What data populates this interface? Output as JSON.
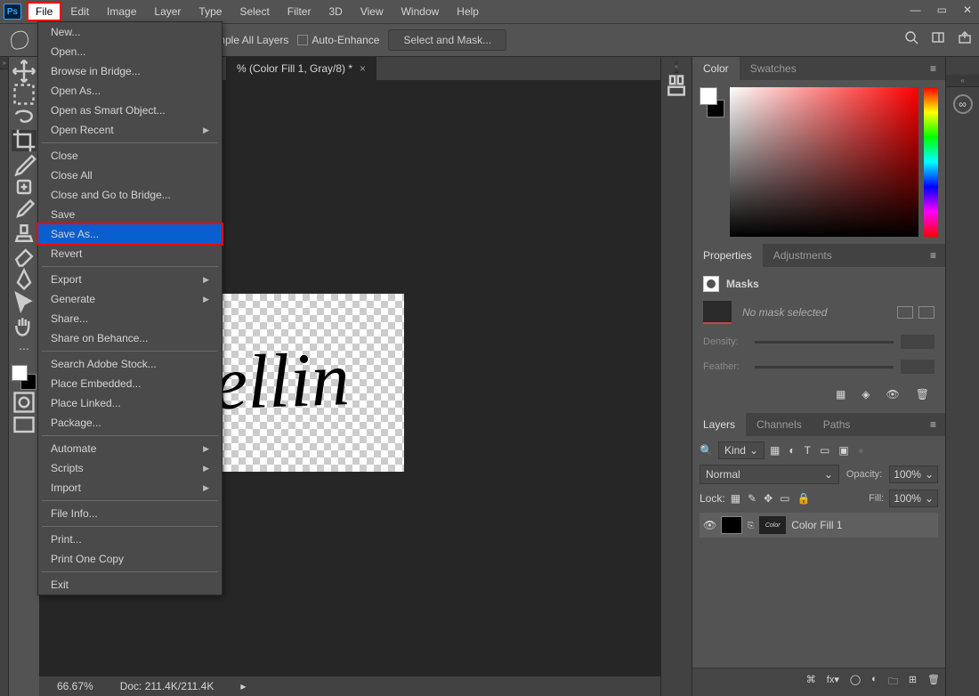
{
  "menubar": {
    "items": [
      "File",
      "Edit",
      "Image",
      "Layer",
      "Type",
      "Select",
      "Filter",
      "3D",
      "View",
      "Window",
      "Help"
    ],
    "active": "File"
  },
  "options_bar": {
    "sample_all": "mple All Layers",
    "auto_enhance": "Auto-Enhance",
    "select_mask": "Select and Mask..."
  },
  "doc_tab": {
    "label": "% (Color Fill 1, Gray/8) *"
  },
  "canvas": {
    "text": "Ravellin"
  },
  "status": {
    "zoom": "66.67%",
    "doc": "Doc: 211.4K/211.4K"
  },
  "file_menu": {
    "g1": [
      "New...",
      "Open...",
      "Browse in Bridge...",
      "Open As...",
      "Open as Smart Object...",
      "Open Recent"
    ],
    "g2": [
      "Close",
      "Close All",
      "Close and Go to Bridge...",
      "Save",
      "Save As...",
      "Revert"
    ],
    "g3": [
      "Export",
      "Generate",
      "Share...",
      "Share on Behance..."
    ],
    "g4": [
      "Search Adobe Stock...",
      "Place Embedded...",
      "Place Linked...",
      "Package..."
    ],
    "g5": [
      "Automate",
      "Scripts",
      "Import"
    ],
    "g6": [
      "File Info..."
    ],
    "g7": [
      "Print...",
      "Print One Copy"
    ],
    "g8": [
      "Exit"
    ],
    "submenu": [
      "Open Recent",
      "Export",
      "Generate",
      "Automate",
      "Scripts",
      "Import"
    ],
    "disabled": [
      "Package..."
    ],
    "highlight": "Save As..."
  },
  "color_panel": {
    "tabs": [
      "Color",
      "Swatches"
    ]
  },
  "props_panel": {
    "tabs": [
      "Properties",
      "Adjustments"
    ],
    "title": "Masks",
    "msg": "No mask selected",
    "density": "Density:",
    "feather": "Feather:"
  },
  "layers_panel": {
    "tabs": [
      "Layers",
      "Channels",
      "Paths"
    ],
    "kind": "Kind",
    "blend": "Normal",
    "opacity_l": "Opacity:",
    "opacity_v": "100%",
    "lock": "Lock:",
    "fill_l": "Fill:",
    "fill_v": "100%",
    "layer_name": "Color Fill 1"
  }
}
